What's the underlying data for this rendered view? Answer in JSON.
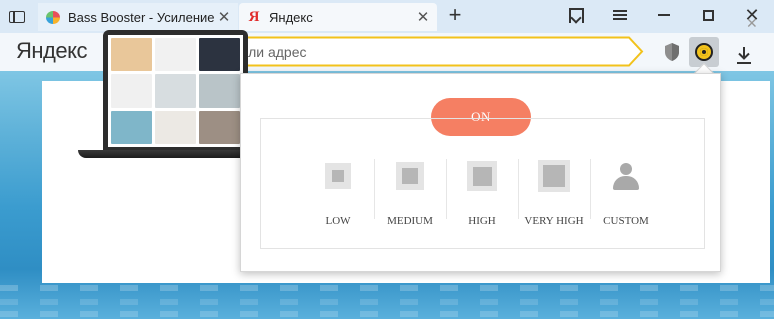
{
  "tabs": [
    {
      "title": "Bass Booster - Усиление Ба",
      "close": "✕",
      "favicon": "bass-booster-favicon"
    },
    {
      "title": "Яндекс",
      "close": "✕",
      "favicon": "yandex-favicon",
      "favicon_glyph": "Я",
      "active": true
    }
  ],
  "window": {
    "new_tab": "+",
    "close": "✕"
  },
  "toolbar": {
    "logo": "Яндекс",
    "search_placeholder": "Введите запрос или адрес"
  },
  "page": {
    "card_close": "✕"
  },
  "popup": {
    "power_label": "ON",
    "presets": [
      {
        "label": "LOW",
        "level": 1
      },
      {
        "label": "MEDIUM",
        "level": 2
      },
      {
        "label": "HIGH",
        "level": 3
      },
      {
        "label": "VERY HIGH",
        "level": 4
      },
      {
        "label": "CUSTOM",
        "icon": "user-icon"
      }
    ]
  },
  "colors": {
    "accent_on": "#f57f63",
    "omnibox_border": "#f2c21b",
    "extension_icon": "#f2c21b"
  }
}
